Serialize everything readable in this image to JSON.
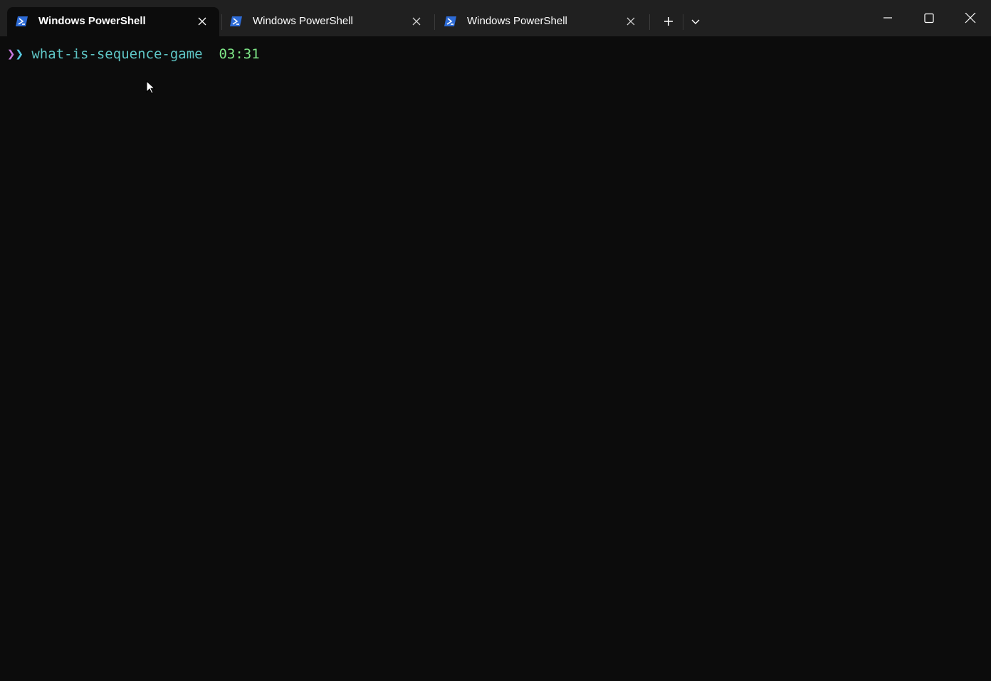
{
  "window": {
    "title": "Windows PowerShell"
  },
  "tabs": [
    {
      "label": "Windows PowerShell",
      "active": true,
      "icon": "powershell-icon"
    },
    {
      "label": "Windows PowerShell",
      "active": false,
      "icon": "powershell-icon"
    },
    {
      "label": "Windows PowerShell",
      "active": false,
      "icon": "powershell-icon"
    }
  ],
  "titlebar_buttons": {
    "new_tab": "plus-icon",
    "dropdown": "chevron-down-icon",
    "minimize": "minimize-icon",
    "maximize": "maximize-icon",
    "close": "close-icon"
  },
  "terminal": {
    "prompt_symbol_1": "❯",
    "prompt_symbol_2": "❯",
    "cwd": "what-is-sequence-game",
    "time": "03:31"
  },
  "colors": {
    "background": "#0c0c0c",
    "titlebar": "#202020",
    "prompt_purple": "#c679dd",
    "prompt_cyan": "#56c8e0",
    "cwd": "#5fc7c7",
    "time": "#7ee787",
    "powershell_icon": "#2d6bd6"
  }
}
